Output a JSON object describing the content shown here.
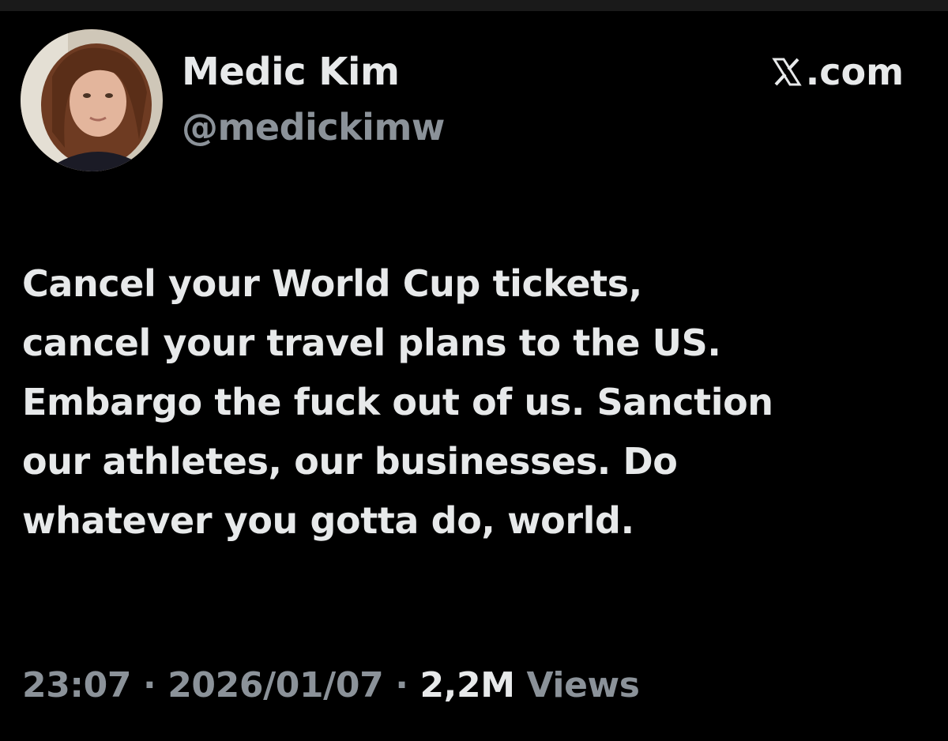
{
  "author": {
    "display_name": "Medic Kim",
    "handle": "@medickimw"
  },
  "brand": {
    "label": ".com",
    "icon": "x-logo-icon"
  },
  "tweet": {
    "lines": [
      "Cancel your World Cup tickets,",
      "cancel your travel plans to the US.",
      "Embargo the fuck out of us. Sanction",
      "our athletes, our businesses. Do",
      "whatever you gotta do, world."
    ]
  },
  "meta": {
    "time": "23:07",
    "separator": " · ",
    "date": "2026/01/07",
    "views_count": "2,2M",
    "views_label": " Views"
  },
  "colors": {
    "background": "#000000",
    "primary_text": "#e7e9ea",
    "secondary_text": "#8b9299"
  }
}
